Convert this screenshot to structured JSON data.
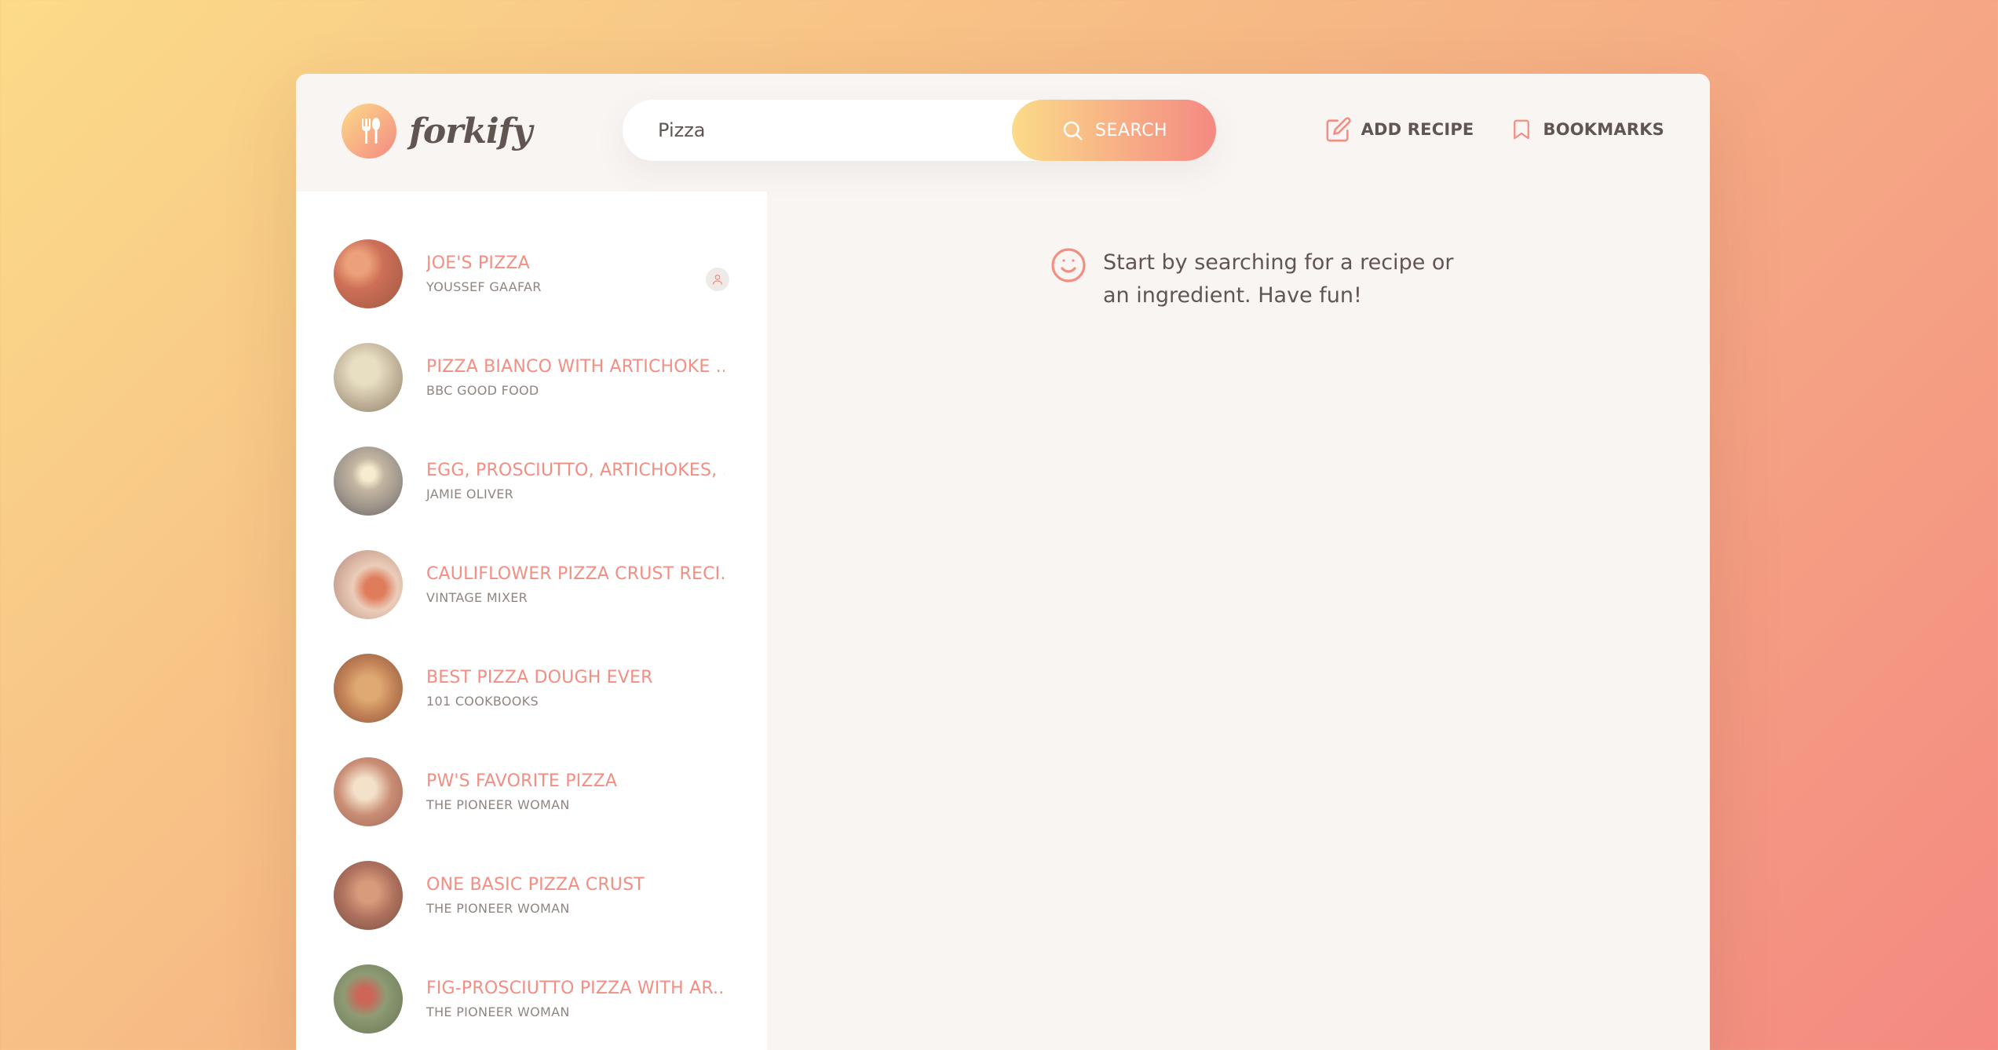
{
  "brand": {
    "name": "forkify"
  },
  "search": {
    "value": "Pizza",
    "button_label": "SEARCH"
  },
  "nav": {
    "add_recipe_label": "ADD RECIPE",
    "bookmarks_label": "BOOKMARKS"
  },
  "results": [
    {
      "title": "JOE'S PIZZA",
      "publisher": "YOUSSEF GAAFAR",
      "user_generated": true,
      "thumb_color": "#c5563a"
    },
    {
      "title": "PIZZA BIANCO WITH ARTICHOKE ...",
      "publisher": "BBC GOOD FOOD",
      "user_generated": false,
      "thumb_color": "#b9a98c"
    },
    {
      "title": "EGG, PROSCIUTTO, ARTICHOKES, ...",
      "publisher": "JAMIE OLIVER",
      "user_generated": false,
      "thumb_color": "#8e8478"
    },
    {
      "title": "CAULIFLOWER PIZZA CRUST RECI...",
      "publisher": "VINTAGE MIXER",
      "user_generated": false,
      "thumb_color": "#c89a86"
    },
    {
      "title": "BEST PIZZA DOUGH EVER",
      "publisher": "101 COOKBOOKS",
      "user_generated": false,
      "thumb_color": "#b66a38"
    },
    {
      "title": "PW'S FAVORITE PIZZA",
      "publisher": "THE PIONEER WOMAN",
      "user_generated": false,
      "thumb_color": "#c17a5e"
    },
    {
      "title": "ONE BASIC PIZZA CRUST",
      "publisher": "THE PIONEER WOMAN",
      "user_generated": false,
      "thumb_color": "#a25a42"
    },
    {
      "title": "FIG-PROSCIUTTO PIZZA WITH AR...",
      "publisher": "THE PIONEER WOMAN",
      "user_generated": false,
      "thumb_color": "#7a8a5c"
    }
  ],
  "message": {
    "text": "Start by searching for a recipe or an ingredient. Have fun!"
  },
  "colors": {
    "accent": "#f38e82",
    "gradient_start": "#fbdb89",
    "gradient_end": "#f48982",
    "text": "#615551"
  }
}
